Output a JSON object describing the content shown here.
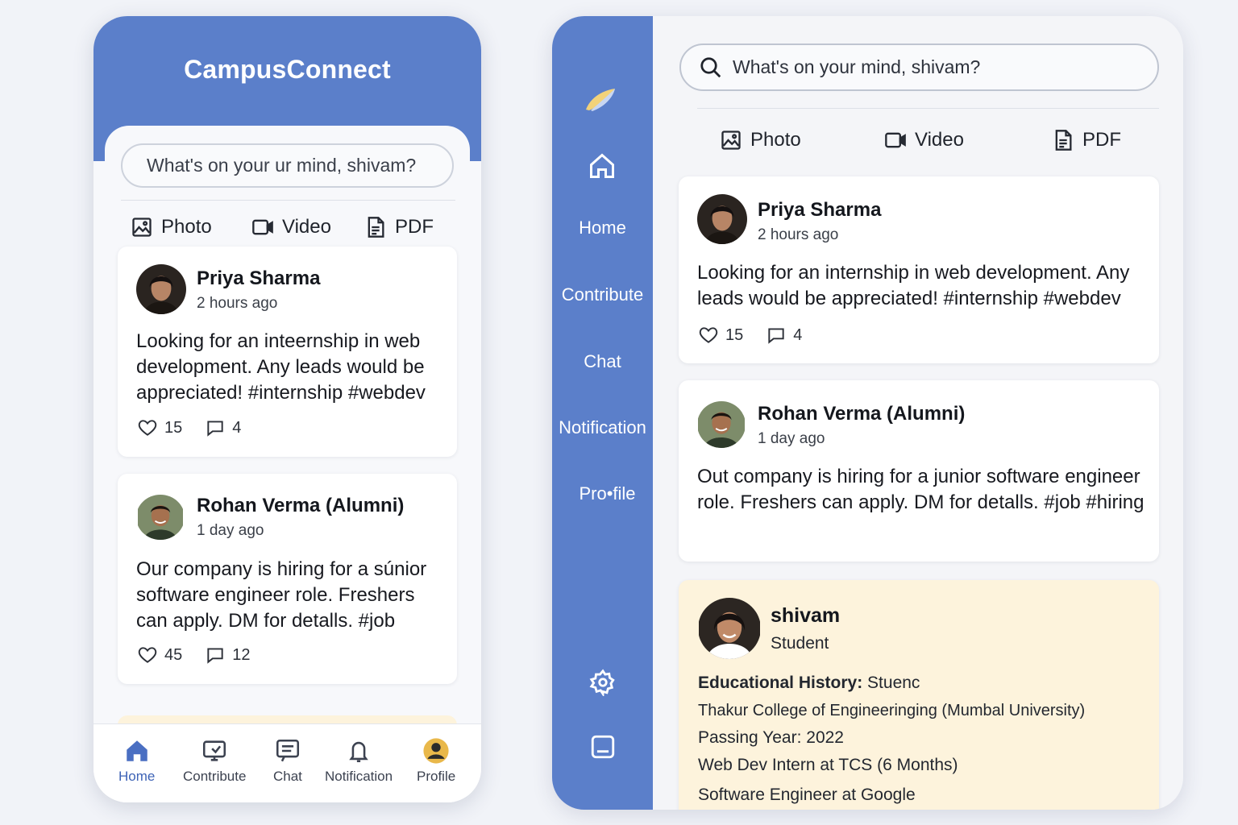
{
  "mobile": {
    "app_title": "CampusConnect",
    "search_placeholder": "What's on your ur mind, shivam?",
    "actions": {
      "photo": "Photo",
      "video": "Video",
      "pdf": "PDF"
    },
    "posts": [
      {
        "author": "Priya Sharma",
        "time": "2 hours ago",
        "text": "Looking for an inteernship in web development. Any leads would be appreciated! #internship #webdev",
        "likes": "15",
        "comments": "4"
      },
      {
        "author": "Rohan Verma (Alumni)",
        "time": "1 day ago",
        "text": "Our company is hiring for a súnior software engineer role. Freshers can apply. DM for detalls. #job",
        "likes": "45",
        "comments": "12"
      }
    ],
    "nav": {
      "home": "Home",
      "contribute": "Contribute",
      "chat": "Chat",
      "notification": "Notification",
      "profile": "Profile"
    }
  },
  "desktop": {
    "search_placeholder": "What's on your mind, shivam?",
    "actions": {
      "photo": "Photo",
      "video": "Video",
      "pdf": "PDF"
    },
    "sidebar": {
      "home": "Home",
      "contribute": "Contribute",
      "chat": "Chat",
      "notification": "Notification",
      "profile": "Pro•file"
    },
    "posts": [
      {
        "author": "Priya Sharma",
        "time": "2 hours ago",
        "text": "Looking for an internship in web development. Any leads would be appreciated! #internship #webdev",
        "likes": "15",
        "comments": "4"
      },
      {
        "author": "Rohan Verma (Alumni)",
        "time": "1 day ago",
        "text": "Out company is hiring for a junior software engineer role. Freshers can apply. DM for detalls. #job #hiring"
      }
    ],
    "profile": {
      "name": "shivam",
      "role": "Student",
      "edu_label": "Educational History:",
      "edu_value": "Stuenc",
      "college": "Thakur College of Engineeringing (Mumbal University)",
      "passing_year": "Passing Year: 2022",
      "exp1_strong": "Web Dev Intern at TCS",
      "exp1_rest": "(6 Months)",
      "exp2": "Software Engineer at Google"
    }
  },
  "colors": {
    "primary": "#5b7fca",
    "active_nav": "#3e63b6",
    "profile_card": "#fdf3dc"
  }
}
